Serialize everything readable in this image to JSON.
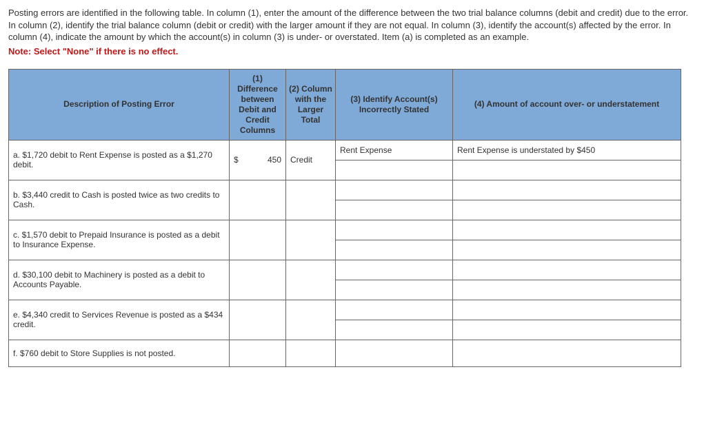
{
  "instructions": "Posting errors are identified in the following table. In column (1), enter the amount of the difference between the two trial balance columns (debit and credit) due to the error. In column (2), identify the trial balance column (debit or credit) with the larger amount if they are not equal. In column (3), identify the account(s) affected by the error. In column (4), indicate the amount by which the account(s) in column (3) is under- or overstated. Item (a) is completed as an example.",
  "note": "Note: Select \"None\" if there is no effect.",
  "headers": {
    "desc": "Description of Posting Error",
    "col1": "(1)\nDifference between Debit and Credit Columns",
    "col2": "(2)\nColumn with the Larger Total",
    "col3": "(3)\nIdentify Account(s) Incorrectly Stated",
    "col4": "(4)\nAmount of account over- or understatement"
  },
  "rows": [
    {
      "desc": "a. $1,720 debit to Rent Expense is posted as a $1,270 debit.",
      "diff_cur": "$",
      "diff_val": "450",
      "col2": "Credit",
      "acct1": "Rent Expense",
      "amt1": "Rent Expense is understated by $450",
      "acct2": "",
      "amt2": ""
    },
    {
      "desc": "b. $3,440 credit to Cash is posted twice as two credits to Cash.",
      "diff_cur": "",
      "diff_val": "",
      "col2": "",
      "acct1": "",
      "amt1": "",
      "acct2": "",
      "amt2": ""
    },
    {
      "desc": "c. $1,570 debit to Prepaid Insurance is posted as a debit to Insurance Expense.",
      "diff_cur": "",
      "diff_val": "",
      "col2": "",
      "acct1": "",
      "amt1": "",
      "acct2": "",
      "amt2": ""
    },
    {
      "desc": "d. $30,100 debit to Machinery is posted as a debit to Accounts Payable.",
      "diff_cur": "",
      "diff_val": "",
      "col2": "",
      "acct1": "",
      "amt1": "",
      "acct2": "",
      "amt2": ""
    },
    {
      "desc": "e. $4,340 credit to Services Revenue is posted as a $434 credit.",
      "diff_cur": "",
      "diff_val": "",
      "col2": "",
      "acct1": "",
      "amt1": "",
      "acct2": "",
      "amt2": ""
    },
    {
      "desc": "f. $760 debit to Store Supplies is not posted.",
      "diff_cur": "",
      "diff_val": "",
      "col2": "",
      "acct1": "",
      "amt1": "",
      "acct2": "",
      "amt2": ""
    }
  ],
  "chart_data": {
    "type": "table",
    "title": "Posting Errors – Trial Balance Differences",
    "columns": [
      "Description of Posting Error",
      "(1) Difference between Debit and Credit Columns",
      "(2) Column with the Larger Total",
      "(3) Identify Account(s) Incorrectly Stated",
      "(4) Amount of account over- or understatement"
    ],
    "rows": [
      [
        "a. $1,720 debit to Rent Expense is posted as a $1,270 debit.",
        "$450",
        "Credit",
        "Rent Expense",
        "Rent Expense is understated by $450"
      ],
      [
        "b. $3,440 credit to Cash is posted twice as two credits to Cash.",
        "",
        "",
        "",
        ""
      ],
      [
        "c. $1,570 debit to Prepaid Insurance is posted as a debit to Insurance Expense.",
        "",
        "",
        "",
        ""
      ],
      [
        "d. $30,100 debit to Machinery is posted as a debit to Accounts Payable.",
        "",
        "",
        "",
        ""
      ],
      [
        "e. $4,340 credit to Services Revenue is posted as a $434 credit.",
        "",
        "",
        "",
        ""
      ],
      [
        "f. $760 debit to Store Supplies is not posted.",
        "",
        "",
        "",
        ""
      ]
    ]
  }
}
